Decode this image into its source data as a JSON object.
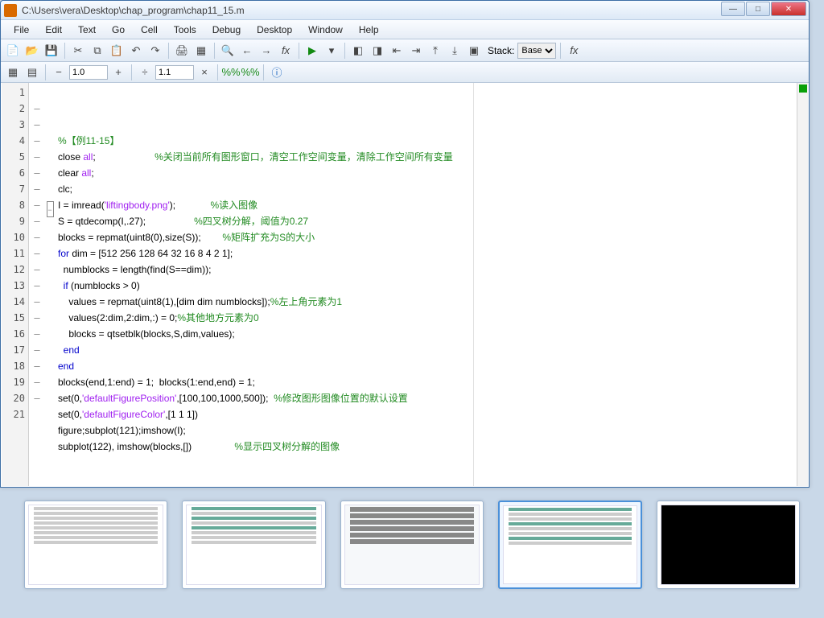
{
  "window": {
    "title": "C:\\Users\\vera\\Desktop\\chap_program\\chap11_15.m"
  },
  "menu": [
    "File",
    "Edit",
    "Text",
    "Go",
    "Cell",
    "Tools",
    "Debug",
    "Desktop",
    "Window",
    "Help"
  ],
  "stack_label": "Stack:",
  "stack_value": "Base",
  "zoom_a": "1.0",
  "zoom_b": "1.1",
  "lines": [
    {
      "n": "1",
      "d": "",
      "html": "<span class='cmt'>%【例11-15】</span>"
    },
    {
      "n": "2",
      "d": "—",
      "html": "close <span class='str'>all</span>;                      <span class='cmt'>%关闭当前所有图形窗口，清空工作空间变量，清除工作空间所有变量</span>"
    },
    {
      "n": "3",
      "d": "—",
      "html": "clear <span class='str'>all</span>;"
    },
    {
      "n": "4",
      "d": "—",
      "html": "clc;"
    },
    {
      "n": "5",
      "d": "—",
      "html": "I = imread(<span class='str'>'liftingbody.png'</span>);             <span class='cmt'>%读入图像</span>"
    },
    {
      "n": "6",
      "d": "—",
      "html": "S = qtdecomp(I,.27);                  <span class='cmt'>%四叉树分解，阈值为0.27</span>"
    },
    {
      "n": "7",
      "d": "—",
      "html": "blocks = repmat(uint8(0),size(S));        <span class='cmt'>%矩阵扩充为S的大小</span>"
    },
    {
      "n": "8",
      "d": "—",
      "html": "<span class='kw'>for</span> dim = [512 256 128 64 32 16 8 4 2 1];"
    },
    {
      "n": "9",
      "d": "—",
      "html": "  numblocks = length(find(S==dim));"
    },
    {
      "n": "10",
      "d": "—",
      "html": "  <span class='kw'>if</span> (numblocks &gt; 0)"
    },
    {
      "n": "11",
      "d": "—",
      "html": "    values = repmat(uint8(1),[dim dim numblocks]);<span class='cmt'>%左上角元素为1</span>"
    },
    {
      "n": "12",
      "d": "—",
      "html": "    values(2:dim,2:dim,:) = 0;<span class='cmt'>%其他地方元素为0</span>"
    },
    {
      "n": "13",
      "d": "—",
      "html": "    blocks = qtsetblk(blocks,S,dim,values);"
    },
    {
      "n": "14",
      "d": "—",
      "html": "  <span class='kw'>end</span>"
    },
    {
      "n": "15",
      "d": "—",
      "html": "<span class='kw'>end</span>"
    },
    {
      "n": "16",
      "d": "—",
      "html": "blocks(end,1:end) = 1;  blocks(1:end,end) = 1;"
    },
    {
      "n": "17",
      "d": "—",
      "html": "set(0,<span class='str'>'defaultFigurePosition'</span>,[100,100,1000,500]);  <span class='cmt'>%修改图形图像位置的默认设置</span>"
    },
    {
      "n": "18",
      "d": "—",
      "html": "set(0,<span class='str'>'defaultFigureColor'</span>,[1 1 1])"
    },
    {
      "n": "19",
      "d": "—",
      "html": "figure;subplot(121);imshow(I);"
    },
    {
      "n": "20",
      "d": "—",
      "html": "subplot(122), imshow(blocks,[])                <span class='cmt'>%显示四叉树分解的图像</span>"
    },
    {
      "n": "21",
      "d": "",
      "html": ""
    }
  ]
}
